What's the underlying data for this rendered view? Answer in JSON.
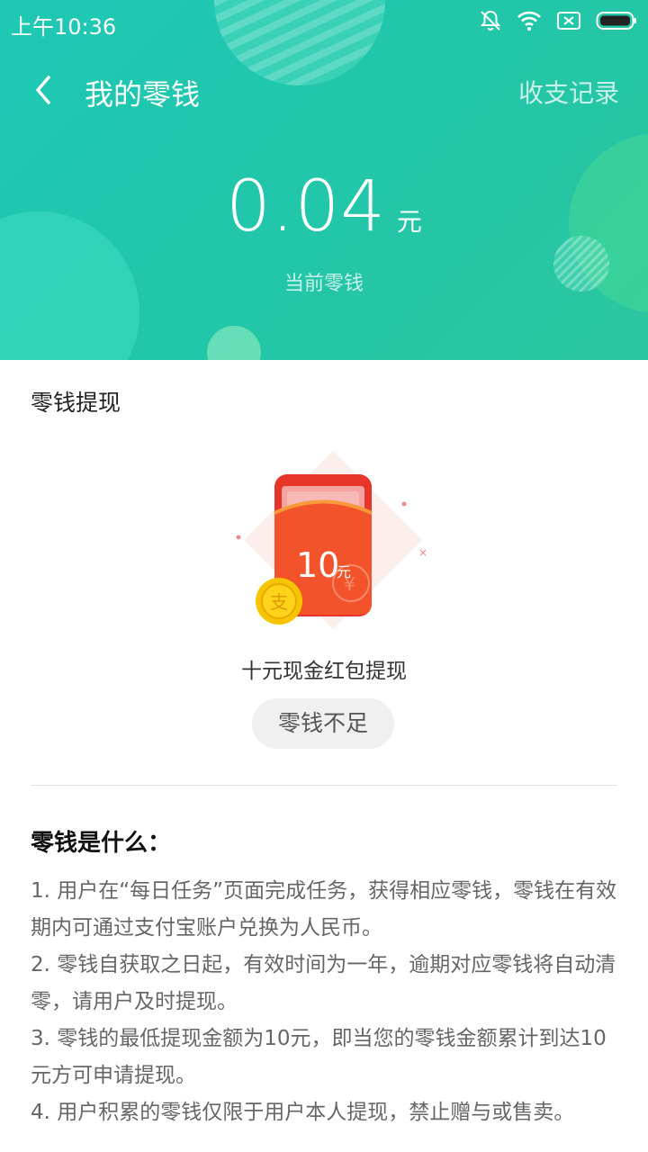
{
  "status_bar": {
    "time": "上午10:36"
  },
  "nav": {
    "title": "我的零钱",
    "record_link": "收支记录"
  },
  "balance": {
    "amount": "0.04",
    "unit": "元",
    "label": "当前零钱"
  },
  "withdraw": {
    "section_title": "零钱提现",
    "card_amount": "10",
    "card_unit": "元",
    "card_caption": "十元现金红包提现",
    "button_label": "零钱不足"
  },
  "faq": {
    "title": "零钱是什么：",
    "items": [
      "1. 用户在“每日任务”页面完成任务，获得相应零钱，零钱在有效期内可通过支付宝账户兑换为人民币。",
      "2. 零钱自获取之日起，有效时间为一年，逾期对应零钱将自动清零，请用户及时提现。",
      "3. 零钱的最低提现金额为10元，即当您的零钱金额累计到达10元方可申请提现。",
      "4. 用户积累的零钱仅限于用户本人提现，禁止赠与或售卖。"
    ]
  },
  "colors": {
    "header_start": "#1ec8b4",
    "header_end": "#2bc7a0",
    "redpacket": "#f0442a",
    "coin": "#f7c500"
  }
}
